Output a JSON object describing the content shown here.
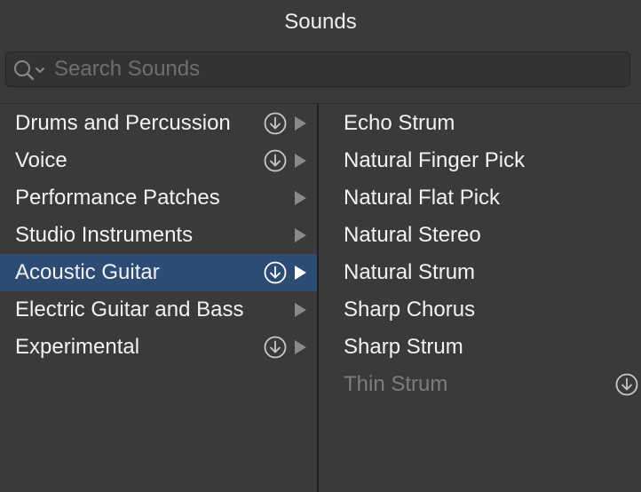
{
  "window": {
    "title": "Sounds"
  },
  "search": {
    "placeholder": "Search Sounds",
    "value": ""
  },
  "categories": [
    {
      "label": "Drums and Percussion",
      "download": true,
      "selected": false
    },
    {
      "label": "Voice",
      "download": true,
      "selected": false
    },
    {
      "label": "Performance Patches",
      "download": false,
      "selected": false
    },
    {
      "label": "Studio Instruments",
      "download": false,
      "selected": false
    },
    {
      "label": "Acoustic Guitar",
      "download": true,
      "selected": true
    },
    {
      "label": "Electric Guitar and Bass",
      "download": false,
      "selected": false
    },
    {
      "label": "Experimental",
      "download": true,
      "selected": false
    }
  ],
  "sounds": [
    {
      "label": "Echo Strum",
      "available": true,
      "download": false
    },
    {
      "label": "Natural Finger Pick",
      "available": true,
      "download": false
    },
    {
      "label": "Natural Flat Pick",
      "available": true,
      "download": false
    },
    {
      "label": "Natural Stereo",
      "available": true,
      "download": false
    },
    {
      "label": "Natural Strum",
      "available": true,
      "download": false
    },
    {
      "label": "Sharp Chorus",
      "available": true,
      "download": false
    },
    {
      "label": "Sharp Strum",
      "available": true,
      "download": false
    },
    {
      "label": "Thin Strum",
      "available": false,
      "download": true
    }
  ],
  "colors": {
    "background": "#3a3a3a",
    "selection": "#2c4c74",
    "text": "#f2f2f2",
    "dim_text": "#7d7d7d",
    "chevron": "#8a8a8a",
    "chevron_selected": "#ffffff"
  },
  "icons": {
    "search": "magnifier-with-chevron-icon",
    "download": "circled-down-arrow-icon",
    "disclosure": "triangle-right-icon"
  }
}
